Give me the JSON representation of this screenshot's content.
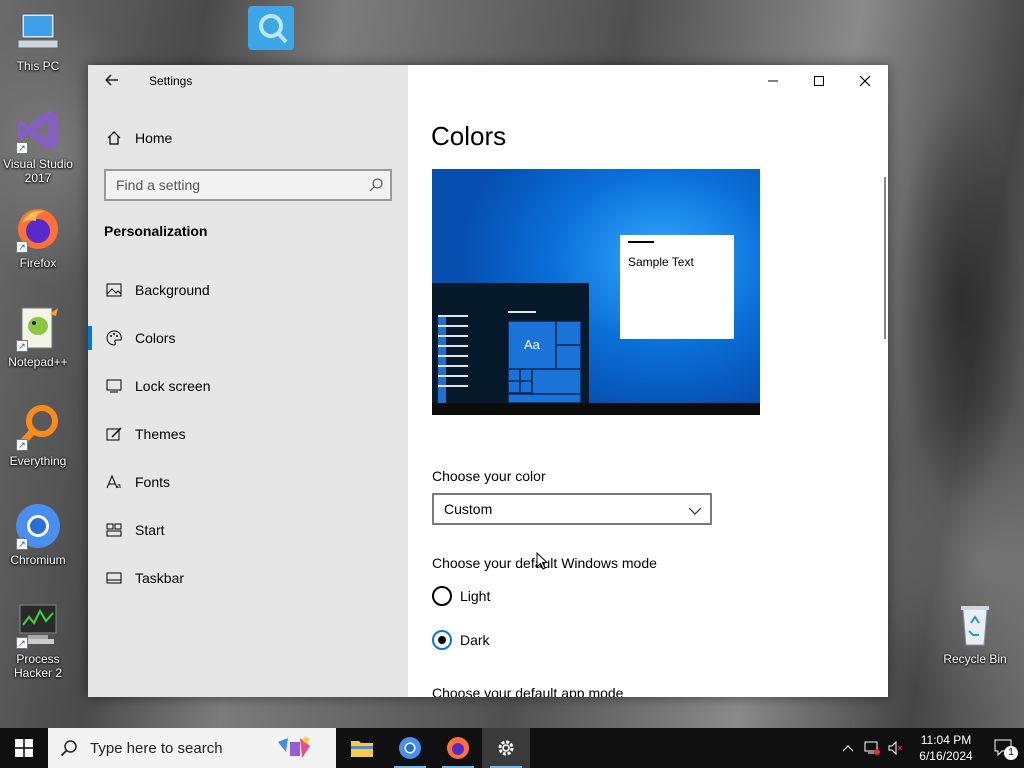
{
  "desktop": {
    "icons": [
      {
        "label": "This PC",
        "icon": "this-pc-icon"
      },
      {
        "label": "Visual Studio 2017",
        "icon": "visual-studio-icon"
      },
      {
        "label": "Firefox",
        "icon": "firefox-icon"
      },
      {
        "label": "Notepad++",
        "icon": "notepadpp-icon"
      },
      {
        "label": "Everything",
        "icon": "everything-icon"
      },
      {
        "label": "Chromium",
        "icon": "chromium-icon"
      },
      {
        "label": "Process Hacker 2",
        "icon": "process-hacker-icon"
      },
      {
        "label": "Recycle Bin",
        "icon": "recycle-bin-icon"
      }
    ]
  },
  "window": {
    "title": "Settings",
    "controls": {
      "minimize": "minimize-icon",
      "maximize": "maximize-icon",
      "close": "close-icon"
    }
  },
  "sidebar": {
    "home": "Home",
    "search_placeholder": "Find a setting",
    "section": "Personalization",
    "items": [
      {
        "label": "Background",
        "icon": "background-icon"
      },
      {
        "label": "Colors",
        "icon": "palette-icon",
        "active": true
      },
      {
        "label": "Lock screen",
        "icon": "lock-screen-icon"
      },
      {
        "label": "Themes",
        "icon": "themes-icon"
      },
      {
        "label": "Fonts",
        "icon": "fonts-icon"
      },
      {
        "label": "Start",
        "icon": "start-icon"
      },
      {
        "label": "Taskbar",
        "icon": "taskbar-icon"
      }
    ]
  },
  "main": {
    "title": "Colors",
    "preview": {
      "tile_text": "Aa",
      "sample_text": "Sample Text"
    },
    "choose_color_label": "Choose your color",
    "choose_color_value": "Custom",
    "windows_mode_label": "Choose your default Windows mode",
    "windows_mode_options": [
      {
        "label": "Light",
        "checked": false
      },
      {
        "label": "Dark",
        "checked": true
      }
    ],
    "app_mode_label": "Choose your default app mode"
  },
  "taskbar": {
    "search_placeholder": "Type here to search",
    "apps": [
      "file-explorer-icon",
      "chromium-icon",
      "firefox-icon",
      "settings-icon"
    ],
    "time": "11:04 PM",
    "date": "6/16/2024",
    "notification_count": "1"
  },
  "colors": {
    "accent": "#0078d7",
    "sidebar_bg": "#e6e6e6",
    "taskbar_bg": "#101010"
  }
}
